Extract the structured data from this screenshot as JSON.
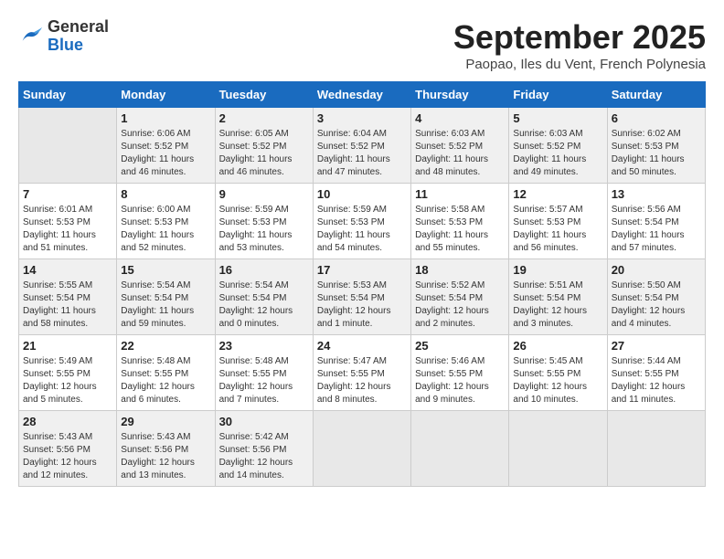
{
  "header": {
    "logo_line1": "General",
    "logo_line2": "Blue",
    "month_title": "September 2025",
    "location": "Paopao, Iles du Vent, French Polynesia"
  },
  "weekdays": [
    "Sunday",
    "Monday",
    "Tuesday",
    "Wednesday",
    "Thursday",
    "Friday",
    "Saturday"
  ],
  "weeks": [
    [
      {
        "day": "",
        "info": ""
      },
      {
        "day": "1",
        "info": "Sunrise: 6:06 AM\nSunset: 5:52 PM\nDaylight: 11 hours\nand 46 minutes."
      },
      {
        "day": "2",
        "info": "Sunrise: 6:05 AM\nSunset: 5:52 PM\nDaylight: 11 hours\nand 46 minutes."
      },
      {
        "day": "3",
        "info": "Sunrise: 6:04 AM\nSunset: 5:52 PM\nDaylight: 11 hours\nand 47 minutes."
      },
      {
        "day": "4",
        "info": "Sunrise: 6:03 AM\nSunset: 5:52 PM\nDaylight: 11 hours\nand 48 minutes."
      },
      {
        "day": "5",
        "info": "Sunrise: 6:03 AM\nSunset: 5:52 PM\nDaylight: 11 hours\nand 49 minutes."
      },
      {
        "day": "6",
        "info": "Sunrise: 6:02 AM\nSunset: 5:53 PM\nDaylight: 11 hours\nand 50 minutes."
      }
    ],
    [
      {
        "day": "7",
        "info": "Sunrise: 6:01 AM\nSunset: 5:53 PM\nDaylight: 11 hours\nand 51 minutes."
      },
      {
        "day": "8",
        "info": "Sunrise: 6:00 AM\nSunset: 5:53 PM\nDaylight: 11 hours\nand 52 minutes."
      },
      {
        "day": "9",
        "info": "Sunrise: 5:59 AM\nSunset: 5:53 PM\nDaylight: 11 hours\nand 53 minutes."
      },
      {
        "day": "10",
        "info": "Sunrise: 5:59 AM\nSunset: 5:53 PM\nDaylight: 11 hours\nand 54 minutes."
      },
      {
        "day": "11",
        "info": "Sunrise: 5:58 AM\nSunset: 5:53 PM\nDaylight: 11 hours\nand 55 minutes."
      },
      {
        "day": "12",
        "info": "Sunrise: 5:57 AM\nSunset: 5:53 PM\nDaylight: 11 hours\nand 56 minutes."
      },
      {
        "day": "13",
        "info": "Sunrise: 5:56 AM\nSunset: 5:54 PM\nDaylight: 11 hours\nand 57 minutes."
      }
    ],
    [
      {
        "day": "14",
        "info": "Sunrise: 5:55 AM\nSunset: 5:54 PM\nDaylight: 11 hours\nand 58 minutes."
      },
      {
        "day": "15",
        "info": "Sunrise: 5:54 AM\nSunset: 5:54 PM\nDaylight: 11 hours\nand 59 minutes."
      },
      {
        "day": "16",
        "info": "Sunrise: 5:54 AM\nSunset: 5:54 PM\nDaylight: 12 hours\nand 0 minutes."
      },
      {
        "day": "17",
        "info": "Sunrise: 5:53 AM\nSunset: 5:54 PM\nDaylight: 12 hours\nand 1 minute."
      },
      {
        "day": "18",
        "info": "Sunrise: 5:52 AM\nSunset: 5:54 PM\nDaylight: 12 hours\nand 2 minutes."
      },
      {
        "day": "19",
        "info": "Sunrise: 5:51 AM\nSunset: 5:54 PM\nDaylight: 12 hours\nand 3 minutes."
      },
      {
        "day": "20",
        "info": "Sunrise: 5:50 AM\nSunset: 5:54 PM\nDaylight: 12 hours\nand 4 minutes."
      }
    ],
    [
      {
        "day": "21",
        "info": "Sunrise: 5:49 AM\nSunset: 5:55 PM\nDaylight: 12 hours\nand 5 minutes."
      },
      {
        "day": "22",
        "info": "Sunrise: 5:48 AM\nSunset: 5:55 PM\nDaylight: 12 hours\nand 6 minutes."
      },
      {
        "day": "23",
        "info": "Sunrise: 5:48 AM\nSunset: 5:55 PM\nDaylight: 12 hours\nand 7 minutes."
      },
      {
        "day": "24",
        "info": "Sunrise: 5:47 AM\nSunset: 5:55 PM\nDaylight: 12 hours\nand 8 minutes."
      },
      {
        "day": "25",
        "info": "Sunrise: 5:46 AM\nSunset: 5:55 PM\nDaylight: 12 hours\nand 9 minutes."
      },
      {
        "day": "26",
        "info": "Sunrise: 5:45 AM\nSunset: 5:55 PM\nDaylight: 12 hours\nand 10 minutes."
      },
      {
        "day": "27",
        "info": "Sunrise: 5:44 AM\nSunset: 5:55 PM\nDaylight: 12 hours\nand 11 minutes."
      }
    ],
    [
      {
        "day": "28",
        "info": "Sunrise: 5:43 AM\nSunset: 5:56 PM\nDaylight: 12 hours\nand 12 minutes."
      },
      {
        "day": "29",
        "info": "Sunrise: 5:43 AM\nSunset: 5:56 PM\nDaylight: 12 hours\nand 13 minutes."
      },
      {
        "day": "30",
        "info": "Sunrise: 5:42 AM\nSunset: 5:56 PM\nDaylight: 12 hours\nand 14 minutes."
      },
      {
        "day": "",
        "info": ""
      },
      {
        "day": "",
        "info": ""
      },
      {
        "day": "",
        "info": ""
      },
      {
        "day": "",
        "info": ""
      }
    ]
  ]
}
